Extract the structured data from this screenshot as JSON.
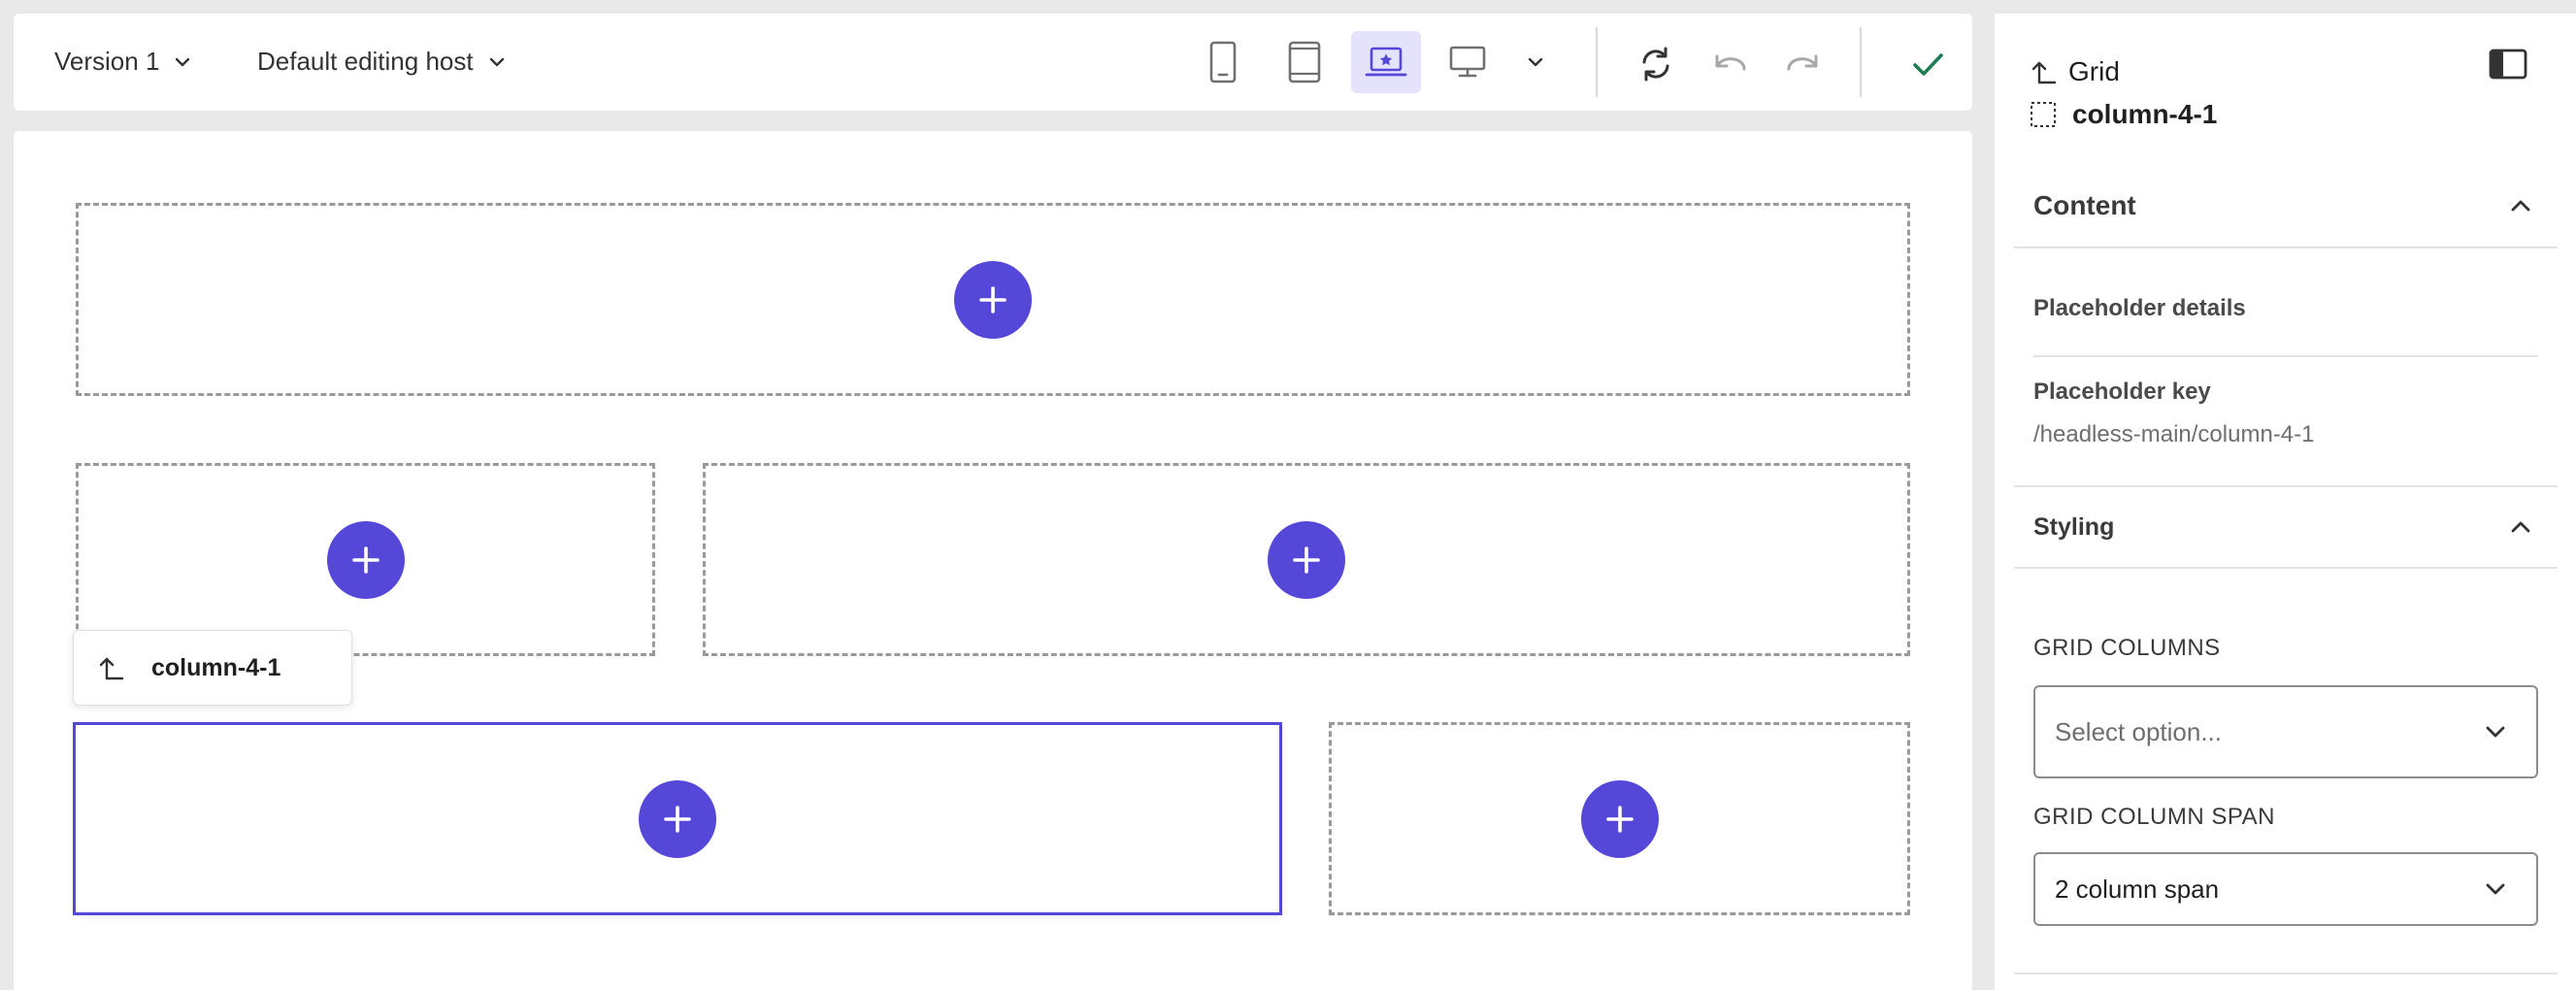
{
  "toolbar": {
    "version_label": "Version 1",
    "host_label": "Default editing host",
    "devices": [
      {
        "name": "mobile",
        "icon": "phone-icon",
        "active": false
      },
      {
        "name": "tablet",
        "icon": "tablet-icon",
        "active": false
      },
      {
        "name": "laptop",
        "icon": "laptop-star-icon",
        "active": true
      },
      {
        "name": "desktop",
        "icon": "monitor-icon",
        "active": false
      }
    ],
    "accent_color": "#5548d9",
    "confirm_color": "#1c7c54"
  },
  "canvas": {
    "selected_chip_label": "column-4-1"
  },
  "panel": {
    "parent_label": "Grid",
    "title": "column-4-1",
    "content_section": {
      "title": "Content",
      "details_title": "Placeholder details",
      "key_label": "Placeholder key",
      "key_value": "/headless-main/column-4-1"
    },
    "styling_section": {
      "title": "Styling",
      "grid_columns_label": "GRID COLUMNS",
      "grid_columns_placeholder": "Select option...",
      "grid_span_label": "GRID COLUMN SPAN",
      "grid_span_value": "2 column span"
    }
  }
}
